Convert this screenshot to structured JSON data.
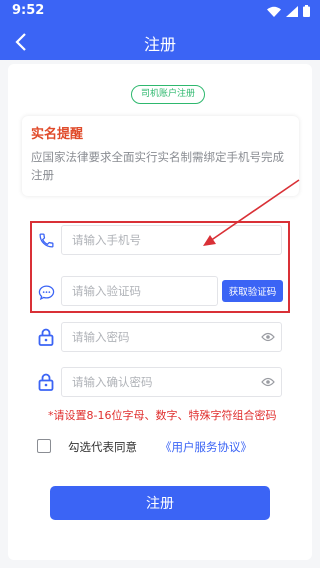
{
  "status_bar": {
    "time": "9:52"
  },
  "nav": {
    "title": "注册"
  },
  "account_tag": "司机账户注册",
  "notice": {
    "title": "实名提醒",
    "body": "应国家法律要求全面实行实名制需绑定手机号完成注册"
  },
  "form": {
    "phone_placeholder": "请输入手机号",
    "code_placeholder": "请输入验证码",
    "get_code_label": "获取验证码",
    "password_placeholder": "请输入密码",
    "confirm_placeholder": "请输入确认密码",
    "password_hint": "*请设置8-16位字母、数字、特殊字符组合密码"
  },
  "agreement": {
    "prefix": "勾选代表同意",
    "link": "《用户服务协议》"
  },
  "submit_label": "注册",
  "colors": {
    "primary": "#3b64f5",
    "tag_green": "#2eb86e",
    "warning_red": "#e0302f",
    "annotation_red": "#d93036"
  }
}
